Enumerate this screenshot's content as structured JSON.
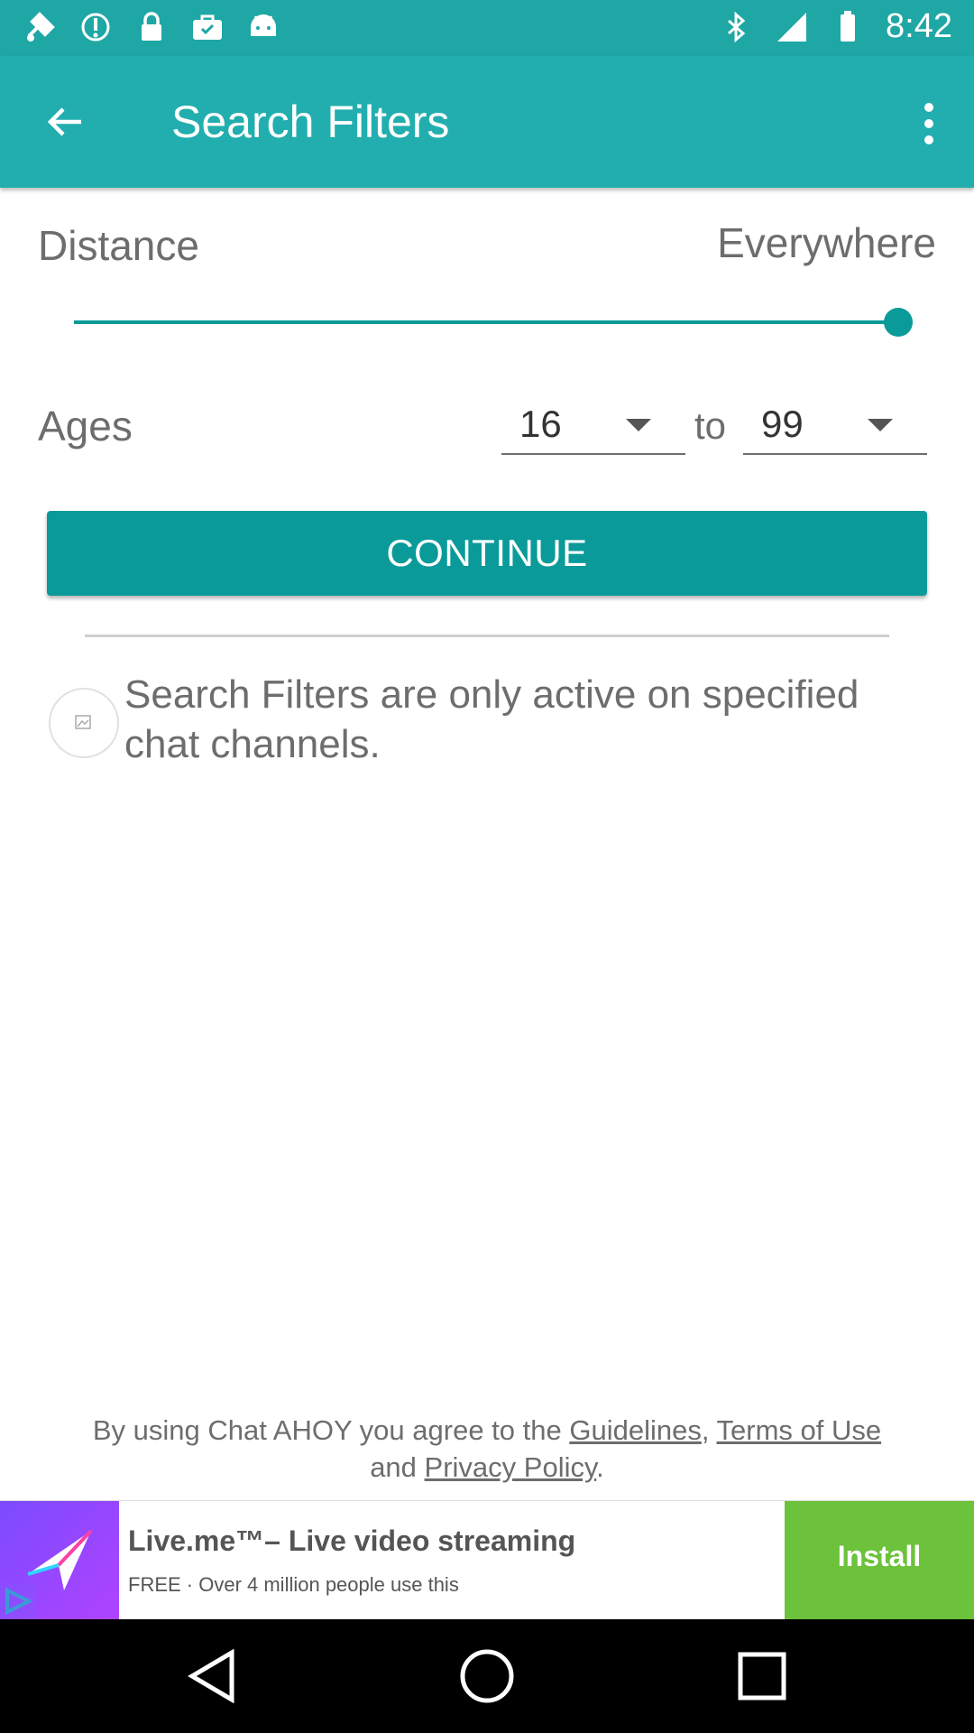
{
  "status_bar": {
    "time": "8:42",
    "icons": [
      "fake-gps-icon",
      "sync-icon",
      "lock-icon",
      "briefcase-icon",
      "android-icon",
      "bluetooth-icon",
      "signal-icon",
      "battery-icon"
    ]
  },
  "app_bar": {
    "title": "Search Filters",
    "back_icon": "arrow-back-icon",
    "menu_icon": "more-vert-icon"
  },
  "distance": {
    "label": "Distance",
    "value": "Everywhere",
    "slider_fraction": 1.0
  },
  "ages": {
    "label": "Ages",
    "min": "16",
    "to_label": "to",
    "max": "99"
  },
  "continue_label": "CONTINUE",
  "info_text": "Search Filters are only active on specified chat channels.",
  "footer": {
    "prefix": "By using Chat AHOY you agree to the ",
    "guidelines": "Guidelines",
    "comma": ", ",
    "terms": "Terms of Use",
    "and": " and ",
    "privacy": "Privacy Policy",
    "period": "."
  },
  "ad": {
    "title": "Live.me™– Live video streaming",
    "subtitle": "FREE · Over 4 million people use this",
    "install_label": "Install"
  },
  "colors": {
    "status_bar": "#1fa7a5",
    "app_bar": "#22aeae",
    "accent": "#0a9a9a",
    "install": "#6cc23a"
  }
}
